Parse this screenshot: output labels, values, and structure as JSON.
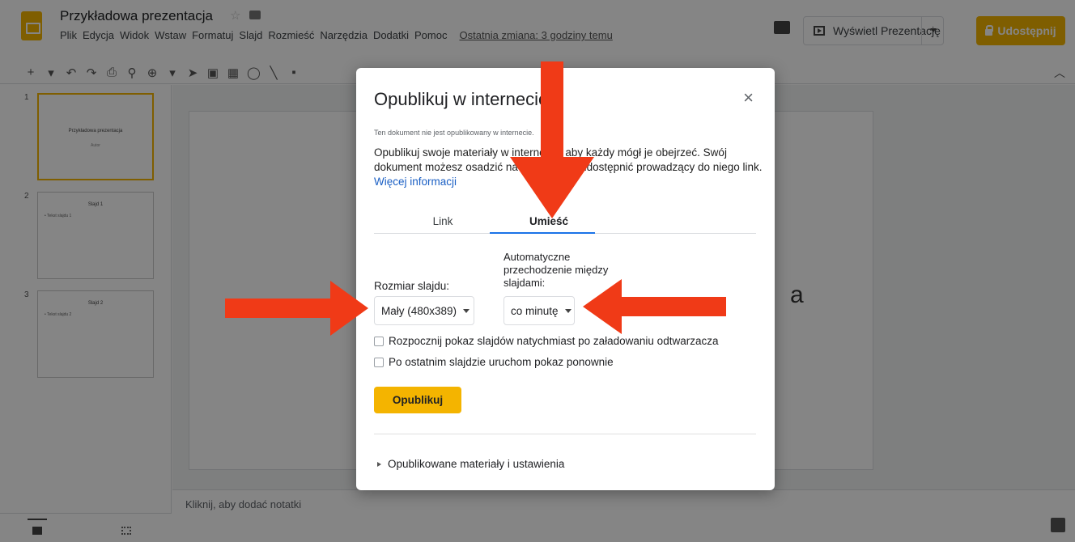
{
  "header": {
    "doc_title": "Przykładowa prezentacja",
    "menu": [
      "Plik",
      "Edycja",
      "Widok",
      "Wstaw",
      "Formatuj",
      "Slajd",
      "Rozmieść",
      "Narzędzia",
      "Dodatki",
      "Pomoc"
    ],
    "last_edit": "Ostatnia zmiana: 3 godziny temu",
    "present_label": "Wyświetl Prezentację",
    "share_label": "Udostępnij"
  },
  "filmstrip": {
    "slides": [
      {
        "number": "1",
        "title": "Przykładowa prezentacja",
        "subtitle": "Autor"
      },
      {
        "number": "2",
        "title": "Slajd 1",
        "bullet": "• Tekst slajdu 1"
      },
      {
        "number": "3",
        "title": "Slajd 2",
        "bullet": "• Tekst slajdu 2"
      }
    ]
  },
  "canvas": {
    "peek_text": "a"
  },
  "notes": {
    "placeholder": "Kliknij, aby dodać notatki"
  },
  "dialog": {
    "title": "Opublikuj w internecie",
    "close_symbol": "×",
    "status": "Ten dokument nie jest opublikowany w internecie.",
    "description": "Opublikuj swoje materiały w internecie, aby każdy mógł je obejrzeć. Swój dokument możesz osadzić na stronie albo udostępnić prowadzący do niego link.",
    "more_info": "Więcej informacji",
    "tabs": [
      "Link",
      "Umieść"
    ],
    "active_tab": "Umieść",
    "size_label": "Rozmiar slajdu:",
    "size_value": "Mały (480x389)",
    "auto_label": "Automatyczne przechodzenie między slajdami:",
    "auto_value": "co minutę",
    "checkbox_start": "Rozpocznij pokaz slajdów natychmiast po załadowaniu odtwarzacza",
    "checkbox_loop": "Po ostatnim slajdzie uruchom pokaz ponownie",
    "publish_label": "Opublikuj",
    "published_section": "Opublikowane materiały i ustawienia"
  },
  "colors": {
    "accent": "#f4b400",
    "link": "#1a5fc4",
    "tab_underline": "#1a73e8",
    "annotation_arrow": "#f03a17"
  }
}
